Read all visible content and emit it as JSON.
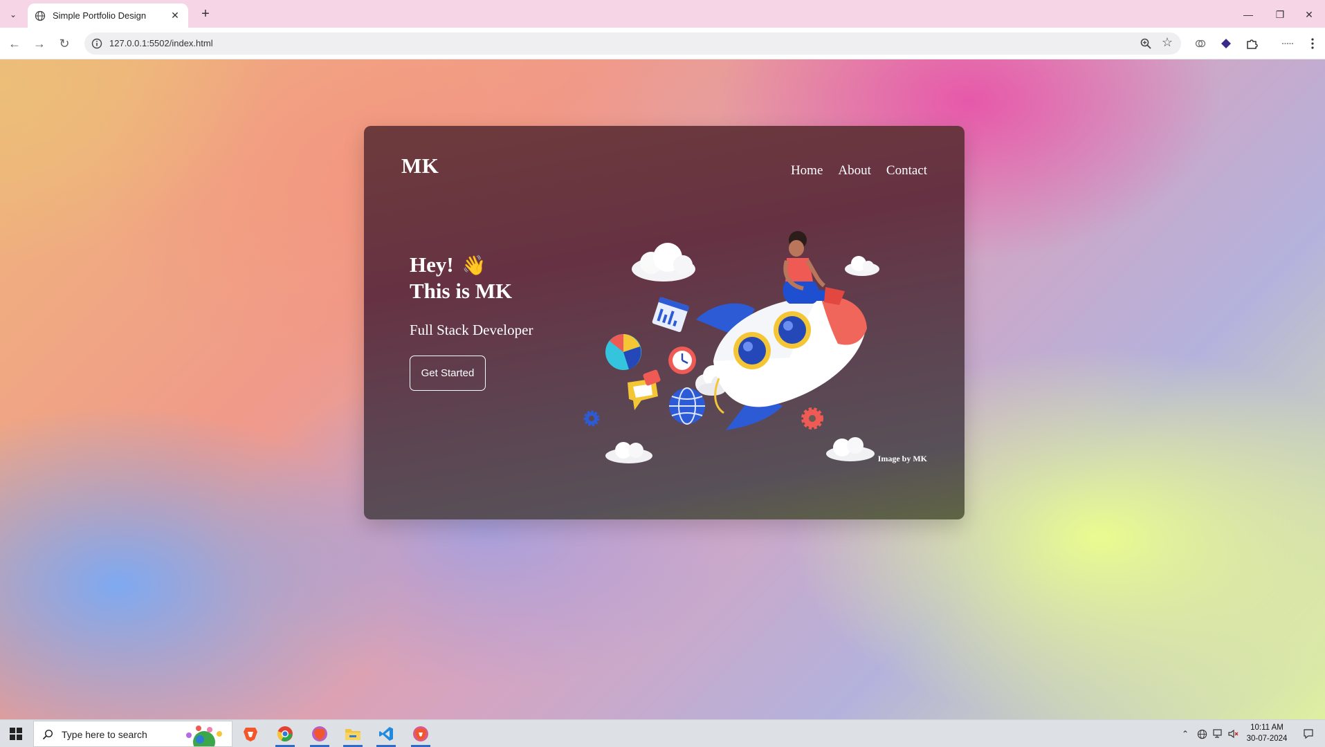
{
  "browser": {
    "tab_title": "Simple Portfolio Design",
    "url": "127.0.0.1:5502/index.html"
  },
  "page": {
    "logo": "MK",
    "nav": [
      "Home",
      "About",
      "Contact"
    ],
    "greeting_line1": "Hey!",
    "wave_emoji": "👋",
    "greeting_line2": "This is MK",
    "role": "Full Stack Developer",
    "cta_label": "Get Started",
    "image_credit": "Image by MK"
  },
  "taskbar": {
    "search_placeholder": "Type here to search",
    "time": "10:11 AM",
    "date": "30-07-2024"
  },
  "colors": {
    "card_top": "#6d3b3c",
    "card_bottom": "#5f6544",
    "tab_strip": "#f6d6e6",
    "taskbar_active": "#2b6cc9"
  }
}
